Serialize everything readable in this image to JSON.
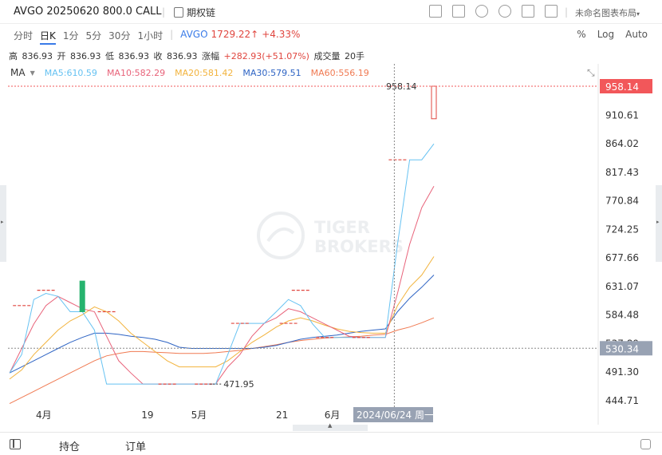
{
  "header": {
    "title": "AVGO 20250620 800.0 CALL",
    "option_chain_label": "期权链",
    "layout_label": "未命名图表布局",
    "icons": [
      "screenshot-icon",
      "edit-icon",
      "refresh-icon",
      "settings-icon",
      "fullscreen-icon",
      "grid-layout-icon"
    ]
  },
  "periods": [
    "分时",
    "日K",
    "1分",
    "5分",
    "30分",
    "1小时"
  ],
  "active_period": "日K",
  "underlying": {
    "symbol": "AVGO",
    "price": "1729.22",
    "change": "+4.33%"
  },
  "right_options": [
    "%",
    "Log",
    "Auto"
  ],
  "ohlc": {
    "high_label": "高",
    "high": "836.93",
    "open_label": "开",
    "open": "836.93",
    "low_label": "低",
    "low": "836.93",
    "close_label": "收",
    "close": "836.93",
    "chg_label": "涨幅",
    "chg": "+282.93(+51.07%)",
    "vol_label": "成交量",
    "vol": "20手"
  },
  "ma": {
    "label": "MA",
    "ma5": "MA5:610.59",
    "ma10": "MA10:582.29",
    "ma20": "MA20:581.42",
    "ma30": "MA30:579.51",
    "ma60": "MA60:556.19"
  },
  "watermark": {
    "line1": "TIGER",
    "line2": "BROKERS"
  },
  "chart_data": {
    "type": "candlestick",
    "y_ticks": [
      "958.14",
      "910.61",
      "864.02",
      "817.43",
      "770.84",
      "724.25",
      "677.66",
      "631.07",
      "584.48",
      "537.89",
      "491.30",
      "444.71"
    ],
    "ylim": [
      444.71,
      958.14
    ],
    "x_labels": [
      "4月",
      "19",
      "5月",
      "21",
      "6月"
    ],
    "crosshair_date": "2024/06/24 周一",
    "crosshair_price": "530.34",
    "last_price_tag": "958.14",
    "max_annotation": "958.14",
    "min_annotation": "471.95",
    "colors": {
      "up": "#e0463f",
      "down": "#26b36e",
      "ma5": "#66c2f2",
      "ma10": "#e8637a",
      "ma20": "#f2b33d",
      "ma30": "#2e64c4",
      "ma60": "#f07a52"
    },
    "x_count": 36,
    "candles": [
      {
        "i": 1,
        "o": 600,
        "c": 600,
        "h": 600,
        "l": 600
      },
      {
        "i": 3,
        "o": 625,
        "c": 625,
        "h": 625,
        "l": 625
      },
      {
        "i": 6,
        "o": 640,
        "c": 590,
        "h": 640,
        "l": 590
      },
      {
        "i": 8,
        "o": 590,
        "c": 590,
        "h": 590,
        "l": 590
      },
      {
        "i": 13,
        "o": 471.95,
        "c": 471.95,
        "h": 471.95,
        "l": 471.95
      },
      {
        "i": 16,
        "o": 471.95,
        "c": 471.95,
        "h": 471.95,
        "l": 471.95
      },
      {
        "i": 19,
        "o": 571,
        "c": 571,
        "h": 571,
        "l": 571
      },
      {
        "i": 23,
        "o": 571,
        "c": 571,
        "h": 571,
        "l": 571
      },
      {
        "i": 24,
        "o": 625,
        "c": 625,
        "h": 625,
        "l": 625
      },
      {
        "i": 26,
        "o": 548,
        "c": 548,
        "h": 548,
        "l": 548
      },
      {
        "i": 29,
        "o": 548,
        "c": 548,
        "h": 548,
        "l": 548
      },
      {
        "i": 32,
        "o": 838,
        "c": 838,
        "h": 838,
        "l": 838
      },
      {
        "i": 35,
        "o": 905,
        "c": 958.14,
        "h": 958.14,
        "l": 905
      }
    ],
    "ma5_values": [
      490,
      520,
      610,
      620,
      615,
      590,
      590,
      560,
      471.95,
      471.95,
      471.95,
      471.95,
      471.95,
      471.95,
      471.95,
      471.95,
      471.95,
      471.95,
      520,
      571,
      571,
      571,
      590,
      610,
      600,
      570,
      548,
      548,
      548,
      548,
      548,
      548,
      700,
      838,
      838,
      864
    ],
    "ma10_values": [
      490,
      530,
      570,
      600,
      615,
      605,
      595,
      590,
      550,
      510,
      490,
      471.95,
      471.95,
      471.95,
      471.95,
      471.95,
      471.95,
      471.95,
      500,
      520,
      550,
      571,
      580,
      595,
      590,
      580,
      570,
      560,
      550,
      548,
      548,
      548,
      620,
      700,
      760,
      795
    ],
    "ma20_values": [
      480,
      495,
      520,
      540,
      560,
      575,
      585,
      598,
      590,
      575,
      555,
      540,
      525,
      510,
      500,
      500,
      500,
      500,
      510,
      525,
      540,
      552,
      565,
      575,
      580,
      575,
      568,
      562,
      558,
      556,
      555,
      555,
      600,
      630,
      650,
      680
    ],
    "ma30_values": [
      490,
      500,
      510,
      520,
      530,
      540,
      548,
      555,
      555,
      553,
      550,
      548,
      545,
      540,
      532,
      530,
      530,
      530,
      530,
      530,
      530,
      532,
      535,
      540,
      545,
      548,
      550,
      552,
      555,
      558,
      560,
      562,
      590,
      612,
      630,
      650
    ],
    "ma60_values": [
      440,
      450,
      460,
      470,
      480,
      490,
      500,
      510,
      518,
      522,
      525,
      525,
      524,
      523,
      522,
      522,
      522,
      523,
      525,
      527,
      530,
      533,
      536,
      540,
      543,
      545,
      547,
      548,
      549,
      550,
      552,
      553,
      560,
      565,
      572,
      580
    ]
  },
  "bottom": {
    "tab1": "持仓",
    "tab2": "订单"
  }
}
